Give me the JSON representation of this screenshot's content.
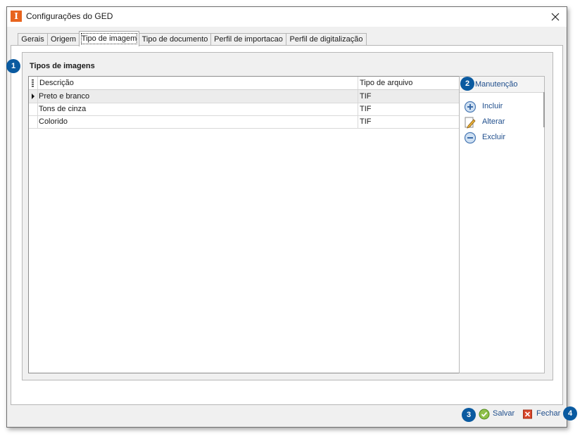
{
  "window": {
    "title": "Configurações do GED"
  },
  "tabs": [
    {
      "label": "Gerais"
    },
    {
      "label": "Origem"
    },
    {
      "label": "Tipo de imagem"
    },
    {
      "label": "Tipo de documento"
    },
    {
      "label": "Perfil de importacao"
    },
    {
      "label": "Perfil de digitalização"
    }
  ],
  "group": {
    "title": "Tipos de imagens",
    "badge": "1"
  },
  "grid": {
    "columns": [
      "Descrição",
      "Tipo de arquivo"
    ],
    "rows": [
      {
        "descricao": "Preto e branco",
        "tipo": "TIF"
      },
      {
        "descricao": "Tons de cinza",
        "tipo": "TIF"
      },
      {
        "descricao": "Colorido",
        "tipo": "TIF"
      }
    ]
  },
  "side": {
    "badge": "2",
    "title": "Manutenção",
    "actions": [
      {
        "label": "Incluir",
        "icon": "plus-circle-icon"
      },
      {
        "label": "Alterar",
        "icon": "edit-pencil-icon"
      },
      {
        "label": "Excluir",
        "icon": "minus-circle-icon"
      }
    ]
  },
  "footer": {
    "save": {
      "badge": "3",
      "label": "Salvar",
      "icon": "check-circle-icon"
    },
    "close": {
      "badge": "4",
      "label": "Fechar",
      "icon": "close-box-icon"
    }
  },
  "colors": {
    "accent": "#0a5aa0",
    "link": "#1f4e8c",
    "app_icon": "#e8641e"
  }
}
